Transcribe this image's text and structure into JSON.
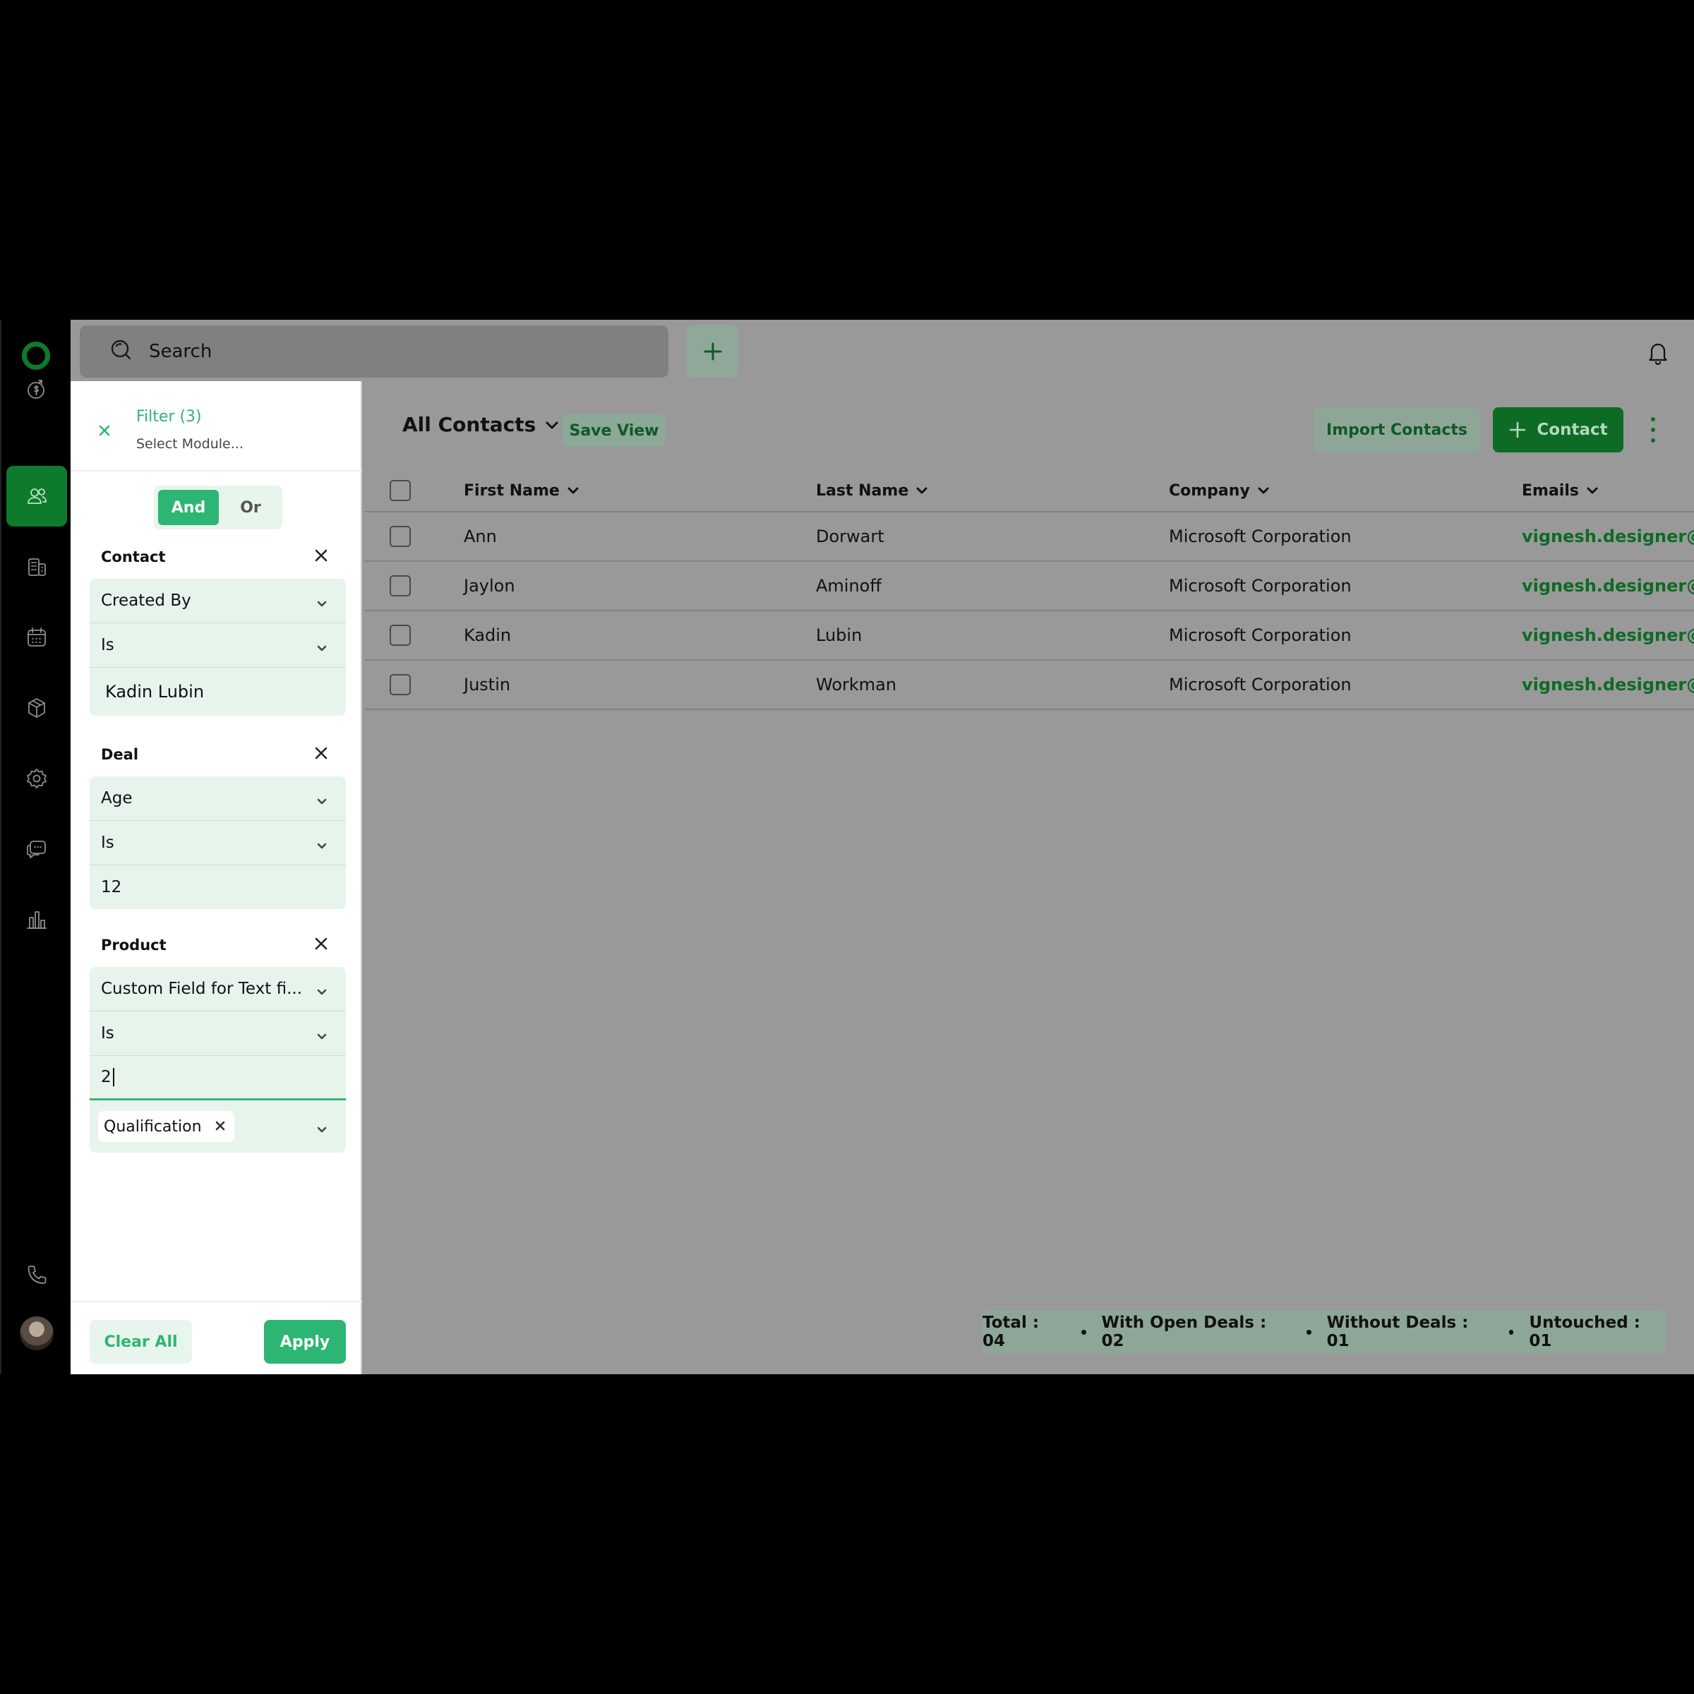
{
  "topbar": {
    "search_placeholder": "Search"
  },
  "content": {
    "view_title": "All Contacts",
    "save_view_label": "Save View",
    "import_label": "Import Contacts",
    "add_contact_label": "Contact"
  },
  "table": {
    "columns": [
      "First Name",
      "Last Name",
      "Company",
      "Emails"
    ],
    "rows": [
      [
        "Ann",
        "Dorwart",
        "Microsoft Corporation",
        "vignesh.designer@mo"
      ],
      [
        "Jaylon",
        "Aminoff",
        "Microsoft Corporation",
        "vignesh.designer@mo"
      ],
      [
        "Kadin",
        "Lubin",
        "Microsoft Corporation",
        "vignesh.designer@mo"
      ],
      [
        "Justin",
        "Workman",
        "Microsoft Corporation",
        "vignesh.designer@mo"
      ]
    ]
  },
  "stats": {
    "total": "Total : 04",
    "open_deals": "With Open Deals : 02",
    "without_deals": "Without Deals : 01",
    "untouched": "Untouched : 01"
  },
  "filter": {
    "title": "Filter (3)",
    "subtitle": "Select Module...",
    "and_label": "And",
    "or_label": "Or",
    "sections": [
      {
        "title": "Contact",
        "field": "Created By",
        "operator": "Is",
        "value": "Kadin Lubin"
      },
      {
        "title": "Deal",
        "field": "Age",
        "operator": "Is",
        "value": "12"
      },
      {
        "title": "Product",
        "field": "Custom Field for Text fi...",
        "operator": "Is",
        "value": "2",
        "tag": "Qualification"
      }
    ],
    "clear_label": "Clear All",
    "apply_label": "Apply"
  },
  "colors": {
    "brand": "#0e6b25",
    "accent": "#2db673",
    "overlay": "#999999"
  },
  "icons": [
    "logo-icon",
    "deals-icon",
    "contacts-icon",
    "companies-icon",
    "calendar-icon",
    "products-icon",
    "settings-icon",
    "chat-icon",
    "reports-icon",
    "phone-icon"
  ]
}
